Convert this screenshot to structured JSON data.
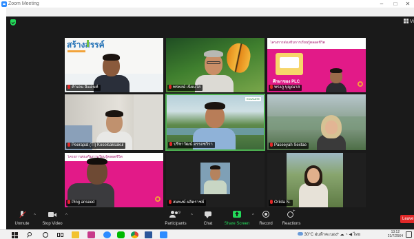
{
  "window": {
    "title": "Zoom Meeting",
    "minimize_glyph": "–",
    "maximize_glyph": "□",
    "close_glyph": "✕"
  },
  "meeting": {
    "view_label": "Vi"
  },
  "participants": [
    {
      "name": "ค้าเอน ฉิมอนท์",
      "slide_title": "สร้างสรรค์"
    },
    {
      "name": "พรพงษ์ เนียมโส"
    },
    {
      "name": "ทรงภู บุญณาส",
      "slide_title": "โครงการส่งเสริมการเรียนรู้ตลอดชีวิต",
      "slide_sub": "ศึกษาของ PLC"
    },
    {
      "name": "Peerapat (TI) Kosolsaksakul"
    },
    {
      "name": "ปรีชาวัฒน์ อรรถชวิรา",
      "brand": "EDUCATE"
    },
    {
      "name": "Paseeyah Sextae"
    },
    {
      "name": "Ping anseed",
      "slide_title": "โครงการส่งเสริมการเรียนรู้ตลอดชีวิต"
    },
    {
      "name": "สมพงษ์ ผลิตราชย์"
    },
    {
      "name": "Orilda N."
    }
  ],
  "controls": {
    "unmute": "Unmute",
    "stop_video": "Stop Video",
    "participants": "Participants",
    "participants_count": "9",
    "chat": "Chat",
    "share_screen": "Share Screen",
    "record": "Record",
    "reactions": "Reactions",
    "leave": "Leave"
  },
  "taskbar": {
    "temperature": "30°C",
    "weather": "ฝนฟ้าคะนอง",
    "lang": "ไทย",
    "time": "13:12",
    "date": "21/7/2564"
  },
  "colors": {
    "zoom_blue": "#2d8cff",
    "share_green": "#23d959",
    "leave_red": "#e02828",
    "slide_pink": "#e21a88"
  }
}
